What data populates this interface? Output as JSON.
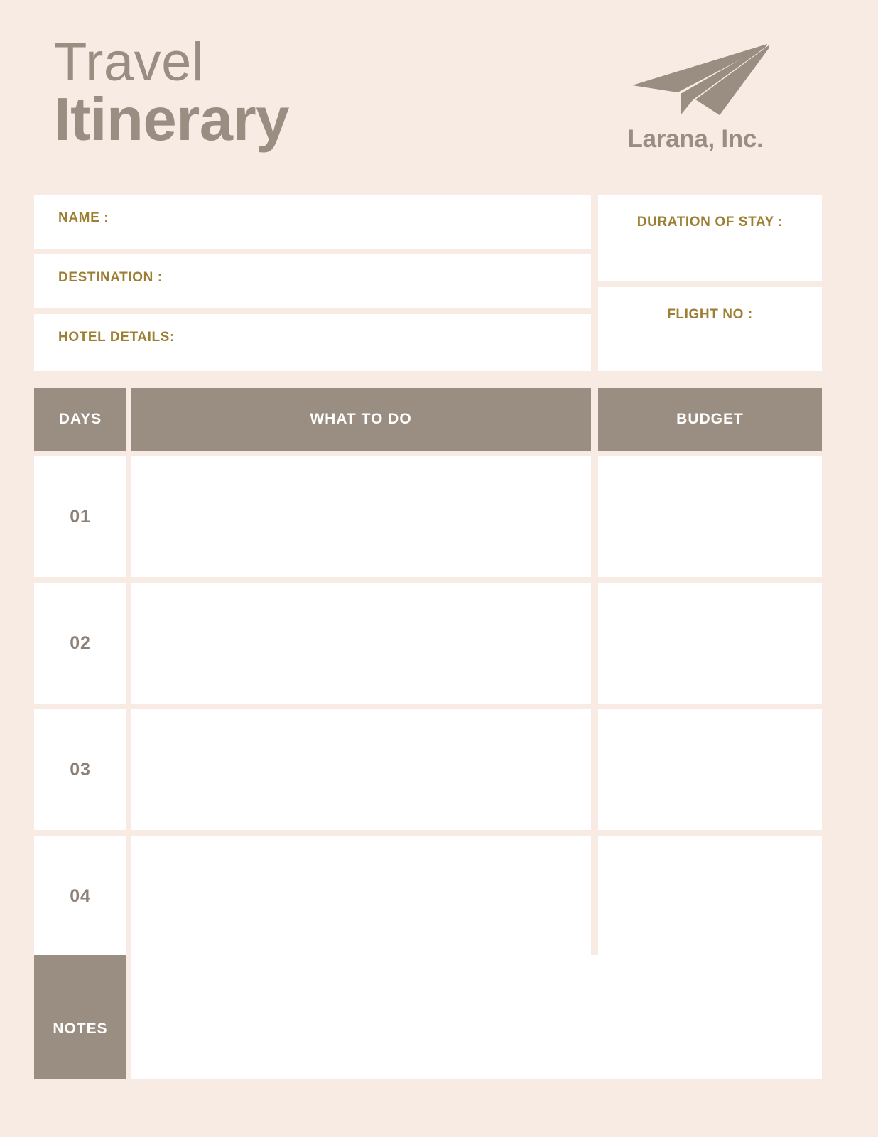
{
  "document": {
    "title_line1": "Travel",
    "title_line2": "Itinerary"
  },
  "brand": {
    "icon": "paper-plane-icon",
    "name": "Larana, Inc."
  },
  "info_fields": {
    "left": [
      {
        "label": "NAME :",
        "value": ""
      },
      {
        "label": "DESTINATION :",
        "value": ""
      },
      {
        "label": "HOTEL DETAILS:",
        "value": ""
      }
    ],
    "right": [
      {
        "label": "DURATION OF STAY :",
        "value": ""
      },
      {
        "label": "FLIGHT NO :",
        "value": ""
      }
    ]
  },
  "table": {
    "headers": {
      "days": "DAYS",
      "what_to_do": "WHAT TO DO",
      "budget": "BUDGET"
    },
    "rows": [
      {
        "day": "01",
        "what_to_do": "",
        "budget": ""
      },
      {
        "day": "02",
        "what_to_do": "",
        "budget": ""
      },
      {
        "day": "03",
        "what_to_do": "",
        "budget": ""
      },
      {
        "day": "04",
        "what_to_do": "",
        "budget": ""
      }
    ]
  },
  "notes": {
    "label": "NOTES",
    "value": ""
  },
  "colors": {
    "background": "#f7ebe3",
    "taupe": "#9a8d82",
    "gold_label": "#9d7f33",
    "field_white": "#ffffff",
    "day_number": "#8d8076"
  }
}
